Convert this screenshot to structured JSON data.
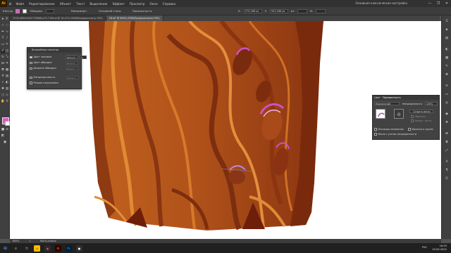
{
  "app": {
    "logo": "Ai",
    "menu": [
      "Файл",
      "Редактирование",
      "Объект",
      "Текст",
      "Выделение",
      "Эффект",
      "Просмотр",
      "Окно",
      "Справка"
    ],
    "workspace": "Основная классическая настройка",
    "window_controls": [
      "—",
      "❐",
      "✕"
    ]
  },
  "controlbar": {
    "selection_label": "Контур",
    "stroke_label": "Обводка:",
    "style_label": "Прозрачность",
    "brush_label": "Равномерн.",
    "brush_style": "Основной стиль",
    "x_value": "375,288 px",
    "y_value": "503,466 px",
    "w_label": "Ш:",
    "h_label": "В:"
  },
  "tabs": [
    {
      "label": "1976-465fc4461778868-p75-7198.ai @ 16.47% (RGB/Предпросмотр GPU)",
      "active": false
    },
    {
      "label": "26.ai* @ 600% (RGB/Предпросмотр GPU)",
      "active": true
    }
  ],
  "blob_dialog": {
    "title": "Волшебная палитра",
    "rows": [
      {
        "label": "Цвет заливки",
        "checked": true,
        "select": "Допуск:",
        "value": "3"
      },
      {
        "label": "Цвет обводки",
        "checked": false,
        "select": "Допуск:",
        "value": ""
      },
      {
        "label": "Ширина обводки",
        "checked": false,
        "select": "Допуск:",
        "value": ""
      },
      {
        "label": "Непрозрачность",
        "checked": false,
        "select": "Допуск:",
        "value": ""
      },
      {
        "label": "Режим наложения",
        "checked": false,
        "select": "",
        "value": ""
      }
    ]
  },
  "transparency_panel": {
    "tabs": [
      "Цвет",
      "Прозрачность"
    ],
    "blend_mode": "Нормальный",
    "opacity_label": "Непрозрачность:",
    "opacity_value": "100%",
    "make_mask": "Создать маску",
    "clip": "Обрезать",
    "invert_mask": "Инверт. маску",
    "isolate_blending": "Изоляция наложения",
    "knockout_group": "Выколка в группе",
    "opacity_defines_knockout": "Маска с учетом непрозрачности",
    "no_icon": "⊘"
  },
  "statusbar": {
    "zoom": "600%",
    "page": "1",
    "tool": "Кисть-клякса"
  },
  "taskbar": {
    "lang": "РУС",
    "time": "16:29",
    "date": "20.05.2022"
  },
  "colors": {
    "fill": "#d95cc0",
    "wood_dark": "#7a2e0c",
    "wood_mid": "#b5541c",
    "wood_light": "#d9822e",
    "highlight": "#d14fc9"
  }
}
